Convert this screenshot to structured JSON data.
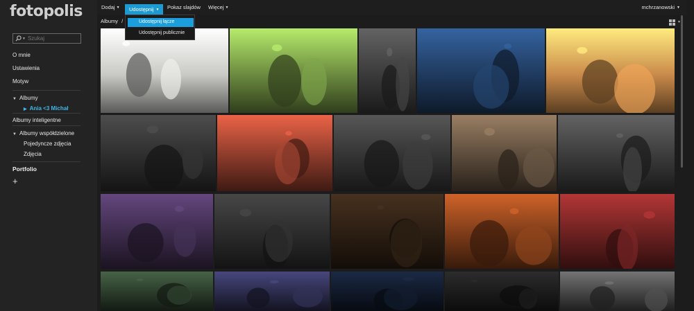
{
  "app": {
    "logo": "fotopolis"
  },
  "search": {
    "placeholder": "Szukaj"
  },
  "sidebar": {
    "items": [
      {
        "label": "O mnie"
      },
      {
        "label": "Ustawienia"
      },
      {
        "label": "Motyw"
      },
      {
        "label": "Albumy"
      },
      {
        "label": "Ania <3 Michał"
      },
      {
        "label": "Albumy inteligentne"
      },
      {
        "label": "Albumy współdzielone"
      },
      {
        "label": "Pojedyncze zdjęcia"
      },
      {
        "label": "Zdjęcia"
      }
    ],
    "portfolio": "Portfolio",
    "add": "+"
  },
  "topbar": {
    "add": "Dodaj",
    "share": "Udostępnij",
    "slideshow": "Pokaz slajdów",
    "more": "Więcej",
    "user": "mchrzanowski"
  },
  "dropdown": {
    "share_link": "Udostępnij łącze",
    "share_public": "Udostępnij publicznie"
  },
  "breadcrumb": {
    "albums": "Albumy",
    "separator": "/"
  },
  "colors": {
    "accent": "#1e9ad3",
    "active_link": "#41b7e8"
  },
  "photos": [
    {
      "name": "photo-kitchen-still-life",
      "tone": "#c9c9c5"
    },
    {
      "name": "photo-couple-outdoor-party",
      "tone": "#6b8a3f"
    },
    {
      "name": "photo-dancing-under-trees",
      "tone": "#3a3a3a"
    },
    {
      "name": "photo-lake-evening-party",
      "tone": "#1f3a5e"
    },
    {
      "name": "photo-bride-groom-sunset",
      "tone": "#c98a4a"
    },
    {
      "name": "photo-first-dance-bw",
      "tone": "#2d2d2d"
    },
    {
      "name": "photo-score-cards-guests",
      "tone": "#8a3a2a"
    },
    {
      "name": "photo-guests-bw",
      "tone": "#333333"
    },
    {
      "name": "photo-dance-floor-color",
      "tone": "#5a4a3a"
    },
    {
      "name": "photo-party-room-bw",
      "tone": "#3a3a3a"
    },
    {
      "name": "photo-cake-table",
      "tone": "#3b2a4a"
    },
    {
      "name": "photo-bride-dancing-bw",
      "tone": "#2a2a2a"
    },
    {
      "name": "photo-grill-pan",
      "tone": "#2a1d12"
    },
    {
      "name": "photo-sign-bread",
      "tone": "#7a3a18"
    },
    {
      "name": "photo-bar-singer",
      "tone": "#6a2020"
    },
    {
      "name": "photo-night-venue",
      "tone": "#2a3a2a"
    },
    {
      "name": "photo-party-stage",
      "tone": "#2a2a4a"
    },
    {
      "name": "photo-string-lights",
      "tone": "#101828"
    },
    {
      "name": "photo-terrace-night-bw",
      "tone": "#1a1a1a"
    },
    {
      "name": "photo-hall-bw",
      "tone": "#444444"
    }
  ]
}
